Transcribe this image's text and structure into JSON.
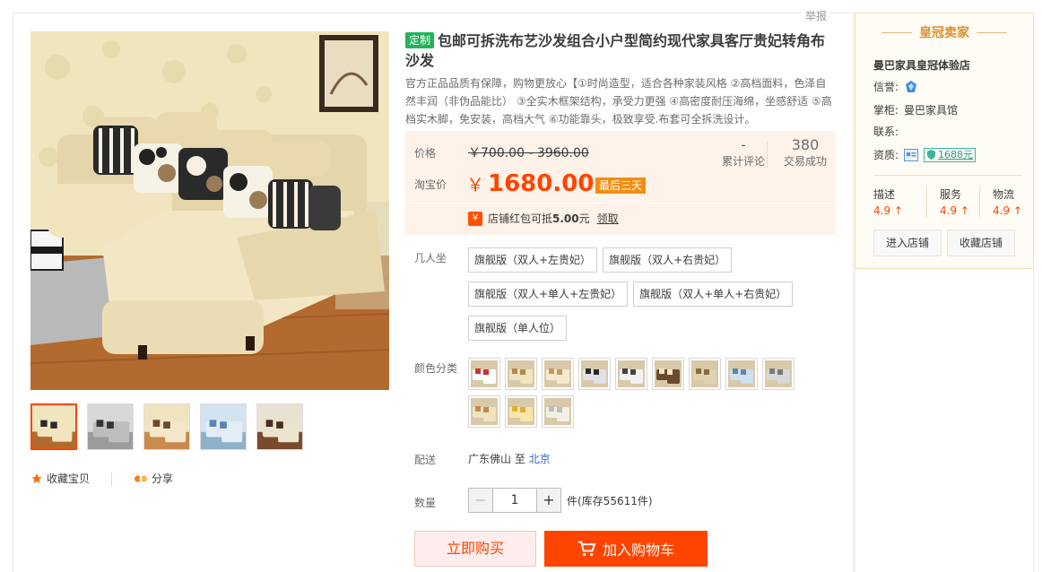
{
  "report_label": "举报",
  "gallery": {
    "thumb_count": 5,
    "favorite_label": "收藏宝贝",
    "share_label": "分享"
  },
  "product": {
    "custom_tag": "定制",
    "title": "包邮可拆洗布艺沙发组合小户型简约现代家具客厅贵妃转角布沙发",
    "subtitle": "官方正品品质有保障，购物更放心【①时尚造型，适合各种家装风格 ②高档面料，色泽自然丰润（非伪品能比） ③全实木框架结构，承受力更强 ④高密度耐压海绵，坐感舒适 ⑤高档实木脚，免安装，高档大气 ⑥功能靠头，极致享受.布套可全拆洗设计。"
  },
  "price": {
    "label": "价格",
    "original": "￥700.00 - 3960.00",
    "taobao_label": "淘宝价",
    "currency": "￥",
    "value": "1680.00",
    "promo_tag": "最后三天",
    "review_count": "-",
    "review_label": "累计评论",
    "sales_count": "380",
    "sales_label": "交易成功",
    "coupon_icon": "￥",
    "coupon_prefix": "店铺红包可抵",
    "coupon_amount": "5.00",
    "coupon_unit": "元",
    "coupon_link": "领取"
  },
  "seats": {
    "label": "几人坐",
    "options": [
      "旗舰版（双人+左贵妃）",
      "旗舰版（双人+右贵妃）",
      "旗舰版（双人+单人+左贵妃）",
      "旗舰版（双人+单人+右贵妃）",
      "旗舰版（单人位）"
    ]
  },
  "color": {
    "label": "颜色分类",
    "swatch_count": 12
  },
  "shipping": {
    "label": "配送",
    "from": "广东佛山",
    "to_word": "至",
    "to": "北京"
  },
  "quantity": {
    "label": "数量",
    "minus": "−",
    "value": "1",
    "plus": "+",
    "stock": "件(库存55611件)"
  },
  "buttons": {
    "buy_now": "立即购买",
    "add_cart": "加入购物车"
  },
  "seller": {
    "header": "皇冠卖家",
    "shop_name": "曼巴家具皇冠体验店",
    "credit_label": "信誉:",
    "manager_label": "掌柜:",
    "manager_value": "曼巴家具馆",
    "contact_label": "联系:",
    "qualification_label": "资质:",
    "badge_1688": "1688元",
    "scores": [
      {
        "label": "描述",
        "value": "4.9 ↑"
      },
      {
        "label": "服务",
        "value": "4.9 ↑"
      },
      {
        "label": "物流",
        "value": "4.9 ↑"
      }
    ],
    "enter_shop": "进入店铺",
    "favorite_shop": "收藏店铺"
  },
  "colors": {
    "accent": "#ff4400",
    "price_bg": "#fff2e8",
    "custom_tag": "#21b359",
    "seller_title": "#e08f2e"
  }
}
